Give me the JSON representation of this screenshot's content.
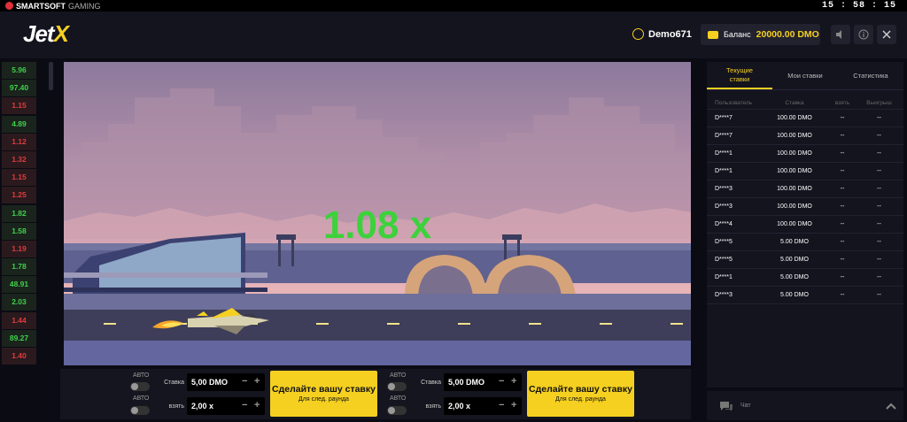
{
  "brand": {
    "name": "SMARTSOFT",
    "suffix": "GAMING"
  },
  "clock": "15 : 58 : 15",
  "logo": {
    "main": "Jet",
    "accent": "X"
  },
  "user": {
    "name": "Demo671"
  },
  "balance": {
    "label": "Баланс",
    "value": "20000.00 DMO"
  },
  "history": [
    {
      "v": "5.96",
      "c": "g"
    },
    {
      "v": "97.40",
      "c": "g"
    },
    {
      "v": "1.15",
      "c": "r"
    },
    {
      "v": "4.89",
      "c": "g"
    },
    {
      "v": "1.12",
      "c": "r"
    },
    {
      "v": "1.32",
      "c": "r"
    },
    {
      "v": "1.15",
      "c": "r"
    },
    {
      "v": "1.25",
      "c": "r"
    },
    {
      "v": "1.82",
      "c": "g"
    },
    {
      "v": "1.58",
      "c": "g"
    },
    {
      "v": "1.19",
      "c": "r"
    },
    {
      "v": "1.78",
      "c": "g"
    },
    {
      "v": "48.91",
      "c": "g"
    },
    {
      "v": "2.03",
      "c": "g"
    },
    {
      "v": "1.44",
      "c": "r"
    },
    {
      "v": "89.27",
      "c": "g"
    },
    {
      "v": "1.40",
      "c": "r"
    }
  ],
  "game": {
    "multiplier": "1.08 x"
  },
  "bet1": {
    "auto1": "АВТО",
    "auto2": "АВТО",
    "stake_label": "Ставка",
    "stake_value": "5,00 DMO",
    "take_label": "взять",
    "take_value": "2,00 x",
    "button": "Сделайте вашу ставку",
    "button_sub": "Для след. раунда"
  },
  "bet2": {
    "auto1": "АВТО",
    "auto2": "АВТО",
    "stake_label": "Ставка",
    "stake_value": "5,00 DMO",
    "take_label": "взять",
    "take_value": "2,00 x",
    "button": "Сделайте вашу ставку",
    "button_sub": "Для след. раунда"
  },
  "tabs": [
    "Текущие\nставки",
    "Мои ставки",
    "Статистика"
  ],
  "table": {
    "headers": [
      "Пользователь",
      "Ставка",
      "взять",
      "Выигрыш"
    ],
    "rows": [
      [
        "D****7",
        "100.00 DMO",
        "--",
        "--"
      ],
      [
        "D****7",
        "100.00 DMO",
        "--",
        "--"
      ],
      [
        "D****1",
        "100.00 DMO",
        "--",
        "--"
      ],
      [
        "D****1",
        "100.00 DMO",
        "--",
        "--"
      ],
      [
        "D****3",
        "100.00 DMO",
        "--",
        "--"
      ],
      [
        "D****3",
        "100.00 DMO",
        "--",
        "--"
      ],
      [
        "D****4",
        "100.00 DMO",
        "--",
        "--"
      ],
      [
        "D****5",
        "5.00 DMO",
        "--",
        "--"
      ],
      [
        "D****5",
        "5.00 DMO",
        "--",
        "--"
      ],
      [
        "D****1",
        "5.00 DMO",
        "--",
        "--"
      ],
      [
        "D****3",
        "5.00 DMO",
        "--",
        "--"
      ]
    ]
  },
  "chat": {
    "label": "Чат"
  }
}
